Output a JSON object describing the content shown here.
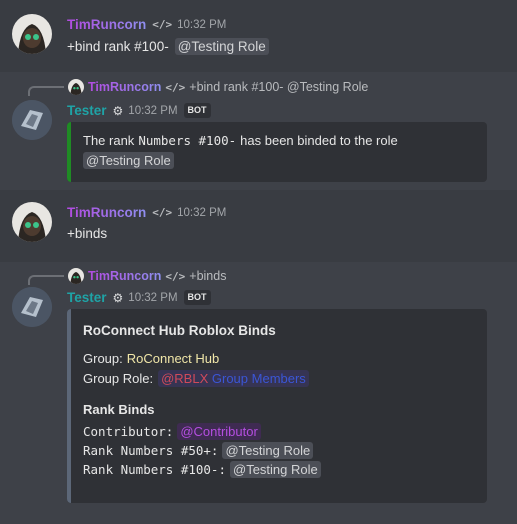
{
  "colors": {
    "background": "#393c42",
    "alt_background": "#3e4148",
    "embed_background": "#2f3136",
    "tim_gradient_start": "#b24be0",
    "tim_gradient_end": "#8f8ff0",
    "tester_name": "#1fa3a6",
    "embed_bar_success": "#1f8b24",
    "embed_bar_binds": "#5c6778",
    "role_red": "#d04a5a",
    "role_purple": "#b44ee0"
  },
  "messages": [
    {
      "author": "TimRuncorn",
      "author_icon": "code-icon",
      "time": "10:32 PM",
      "content": "+bind rank #100-",
      "mention": "@Testing Role"
    },
    {
      "reply": {
        "author": "TimRuncorn",
        "author_icon": "code-icon",
        "text": "+bind rank #100- @Testing Role"
      },
      "author": "Tester",
      "author_icon": "bot-dev-icon",
      "time": "10:32 PM",
      "badge": "BOT",
      "embed": {
        "line1_prefix": "The rank",
        "line1_code": "Numbers #100-",
        "line1_suffix": "has been binded to the role",
        "mention": "@Testing Role"
      }
    },
    {
      "author": "TimRuncorn",
      "author_icon": "code-icon",
      "time": "10:32 PM",
      "content": "+binds"
    },
    {
      "reply": {
        "author": "TimRuncorn",
        "author_icon": "code-icon",
        "text": "+binds"
      },
      "author": "Tester",
      "author_icon": "bot-dev-icon",
      "time": "10:32 PM",
      "badge": "BOT",
      "embed": {
        "title": "RoConnect Hub Roblox Binds",
        "group_label": "Group:",
        "group_value": "RoConnect Hub",
        "group_role_label": "Group Role:",
        "group_role_value_a": "@RBLX",
        "group_role_value_b": "Group Members",
        "section_title": "Rank Binds",
        "binds": [
          {
            "rank": "Contributor:",
            "role": "@Contributor"
          },
          {
            "rank": "Rank Numbers #50+:",
            "role": "@Testing Role"
          },
          {
            "rank": "Rank Numbers #100-:",
            "role": "@Testing Role"
          }
        ]
      }
    }
  ]
}
